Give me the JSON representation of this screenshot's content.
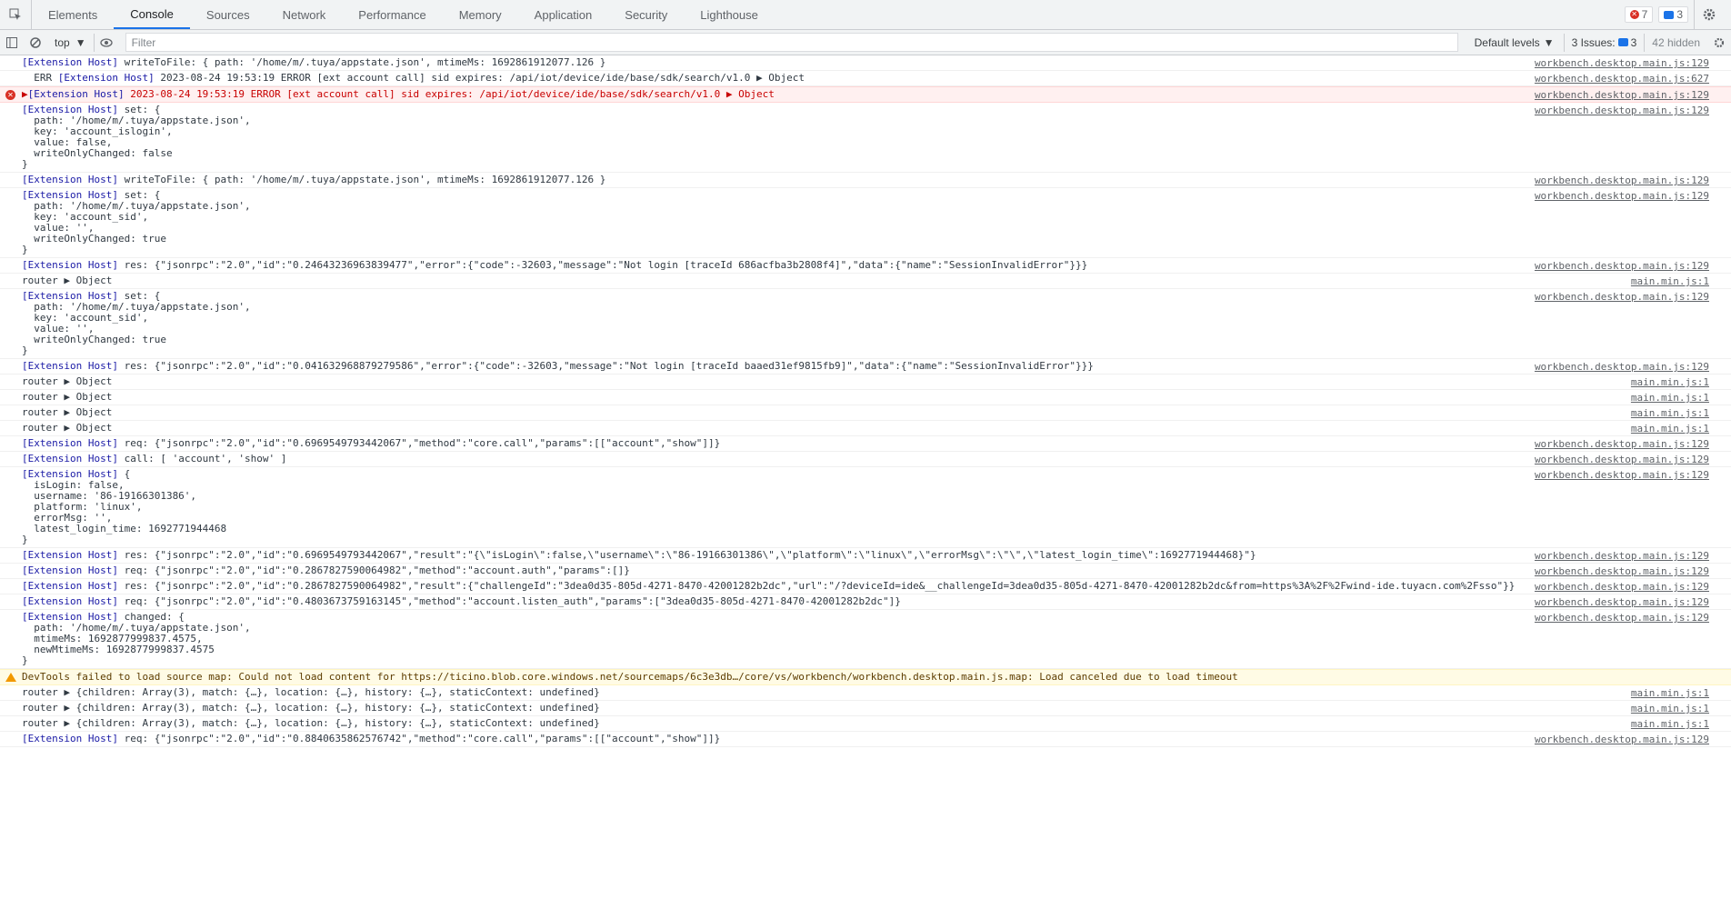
{
  "tabs": [
    "Elements",
    "Console",
    "Sources",
    "Network",
    "Performance",
    "Memory",
    "Application",
    "Security",
    "Lighthouse"
  ],
  "active_tab": "Console",
  "counts": {
    "errors": "7",
    "messages": "3"
  },
  "toolbar": {
    "context": "top",
    "filter_placeholder": "Filter",
    "levels": "Default levels",
    "issues_label": "3 Issues:",
    "issues_count": "3",
    "hidden": "42 hidden"
  },
  "rows": [
    {
      "kind": "log",
      "lines": [
        "[Extension Host] writeToFile: { path: '/home/m/.tuya/appstate.json', mtimeMs: 1692861912077.126 }"
      ],
      "source": "workbench.desktop.main.js:129"
    },
    {
      "kind": "log",
      "lines": [
        "  ERR [Extension Host] 2023-08-24 19:53:19 ERROR [ext account call] sid expires: /api/iot/device/ide/base/sdk/search/v1.0 ▶ Object"
      ],
      "source": "workbench.desktop.main.js:627"
    },
    {
      "kind": "error",
      "lines": [
        "▶[Extension Host] 2023-08-24 19:53:19 ERROR [ext account call] sid expires: /api/iot/device/ide/base/sdk/search/v1.0 ▶ Object"
      ],
      "source": "workbench.desktop.main.js:129"
    },
    {
      "kind": "log",
      "lines": [
        "[Extension Host] set: {",
        "  path: '/home/m/.tuya/appstate.json',",
        "  key: 'account_islogin',",
        "  value: false,",
        "  writeOnlyChanged: false",
        "}"
      ],
      "source": "workbench.desktop.main.js:129"
    },
    {
      "kind": "log",
      "lines": [
        "[Extension Host] writeToFile: { path: '/home/m/.tuya/appstate.json', mtimeMs: 1692861912077.126 }"
      ],
      "source": "workbench.desktop.main.js:129"
    },
    {
      "kind": "log",
      "lines": [
        "[Extension Host] set: {",
        "  path: '/home/m/.tuya/appstate.json',",
        "  key: 'account_sid',",
        "  value: '',",
        "  writeOnlyChanged: true",
        "}"
      ],
      "source": "workbench.desktop.main.js:129"
    },
    {
      "kind": "log",
      "lines": [
        "[Extension Host] res: {\"jsonrpc\":\"2.0\",\"id\":\"0.24643236963839477\",\"error\":{\"code\":-32603,\"message\":\"Not login [traceId 686acfba3b2808f4]\",\"data\":{\"name\":\"SessionInvalidError\"}}}"
      ],
      "source": "workbench.desktop.main.js:129"
    },
    {
      "kind": "log",
      "lines": [
        "router ▶ Object"
      ],
      "source": "main.min.js:1"
    },
    {
      "kind": "log",
      "lines": [
        "[Extension Host] set: {",
        "  path: '/home/m/.tuya/appstate.json',",
        "  key: 'account_sid',",
        "  value: '',",
        "  writeOnlyChanged: true",
        "}"
      ],
      "source": "workbench.desktop.main.js:129"
    },
    {
      "kind": "log",
      "lines": [
        "[Extension Host] res: {\"jsonrpc\":\"2.0\",\"id\":\"0.041632968879279586\",\"error\":{\"code\":-32603,\"message\":\"Not login [traceId baaed31ef9815fb9]\",\"data\":{\"name\":\"SessionInvalidError\"}}}"
      ],
      "source": "workbench.desktop.main.js:129"
    },
    {
      "kind": "log",
      "lines": [
        "router ▶ Object"
      ],
      "source": "main.min.js:1"
    },
    {
      "kind": "log",
      "lines": [
        "router ▶ Object"
      ],
      "source": "main.min.js:1"
    },
    {
      "kind": "log",
      "lines": [
        "router ▶ Object"
      ],
      "source": "main.min.js:1"
    },
    {
      "kind": "log",
      "lines": [
        "router ▶ Object"
      ],
      "source": "main.min.js:1"
    },
    {
      "kind": "log",
      "lines": [
        "[Extension Host] req: {\"jsonrpc\":\"2.0\",\"id\":\"0.6969549793442067\",\"method\":\"core.call\",\"params\":[[\"account\",\"show\"]]}"
      ],
      "source": "workbench.desktop.main.js:129"
    },
    {
      "kind": "log",
      "lines": [
        "[Extension Host] call: [ 'account', 'show' ]"
      ],
      "source": "workbench.desktop.main.js:129"
    },
    {
      "kind": "log",
      "lines": [
        "[Extension Host] {",
        "  isLogin: false,",
        "  username: '86-19166301386',",
        "  platform: 'linux',",
        "  errorMsg: '',",
        "  latest_login_time: 1692771944468",
        "}"
      ],
      "source": "workbench.desktop.main.js:129"
    },
    {
      "kind": "log",
      "lines": [
        "[Extension Host] res: {\"jsonrpc\":\"2.0\",\"id\":\"0.6969549793442067\",\"result\":\"{\\\"isLogin\\\":false,\\\"username\\\":\\\"86-19166301386\\\",\\\"platform\\\":\\\"linux\\\",\\\"errorMsg\\\":\\\"\\\",\\\"latest_login_time\\\":1692771944468}\"}"
      ],
      "source": "workbench.desktop.main.js:129"
    },
    {
      "kind": "log",
      "lines": [
        "[Extension Host] req: {\"jsonrpc\":\"2.0\",\"id\":\"0.2867827590064982\",\"method\":\"account.auth\",\"params\":[]}"
      ],
      "source": "workbench.desktop.main.js:129"
    },
    {
      "kind": "log",
      "lines": [
        "[Extension Host] res: {\"jsonrpc\":\"2.0\",\"id\":\"0.2867827590064982\",\"result\":{\"challengeId\":\"3dea0d35-805d-4271-8470-42001282b2dc\",\"url\":\"/?deviceId=ide&__challengeId=3dea0d35-805d-4271-8470-42001282b2dc&from=https%3A%2F%2Fwind-ide.tuyacn.com%2Fsso\"}}"
      ],
      "source": "workbench.desktop.main.js:129"
    },
    {
      "kind": "log",
      "lines": [
        "[Extension Host] req: {\"jsonrpc\":\"2.0\",\"id\":\"0.4803673759163145\",\"method\":\"account.listen_auth\",\"params\":[\"3dea0d35-805d-4271-8470-42001282b2dc\"]}"
      ],
      "source": "workbench.desktop.main.js:129"
    },
    {
      "kind": "log",
      "lines": [
        "[Extension Host] changed: {",
        "  path: '/home/m/.tuya/appstate.json',",
        "  mtimeMs: 1692877999837.4575,",
        "  newMtimeMs: 1692877999837.4575",
        "}"
      ],
      "source": "workbench.desktop.main.js:129"
    },
    {
      "kind": "warn",
      "lines": [
        "DevTools failed to load source map: Could not load content for https://ticino.blob.core.windows.net/sourcemaps/6c3e3db…/core/vs/workbench/workbench.desktop.main.js.map: Load canceled due to load timeout"
      ],
      "source": ""
    },
    {
      "kind": "log",
      "lines": [
        "router ▶ {children: Array(3), match: {…}, location: {…}, history: {…}, staticContext: undefined}"
      ],
      "source": "main.min.js:1"
    },
    {
      "kind": "log",
      "lines": [
        "router ▶ {children: Array(3), match: {…}, location: {…}, history: {…}, staticContext: undefined}"
      ],
      "source": "main.min.js:1"
    },
    {
      "kind": "log",
      "lines": [
        "router ▶ {children: Array(3), match: {…}, location: {…}, history: {…}, staticContext: undefined}"
      ],
      "source": "main.min.js:1"
    },
    {
      "kind": "log",
      "lines": [
        "[Extension Host] req: {\"jsonrpc\":\"2.0\",\"id\":\"0.8840635862576742\",\"method\":\"core.call\",\"params\":[[\"account\",\"show\"]]}"
      ],
      "source": "workbench.desktop.main.js:129"
    }
  ]
}
